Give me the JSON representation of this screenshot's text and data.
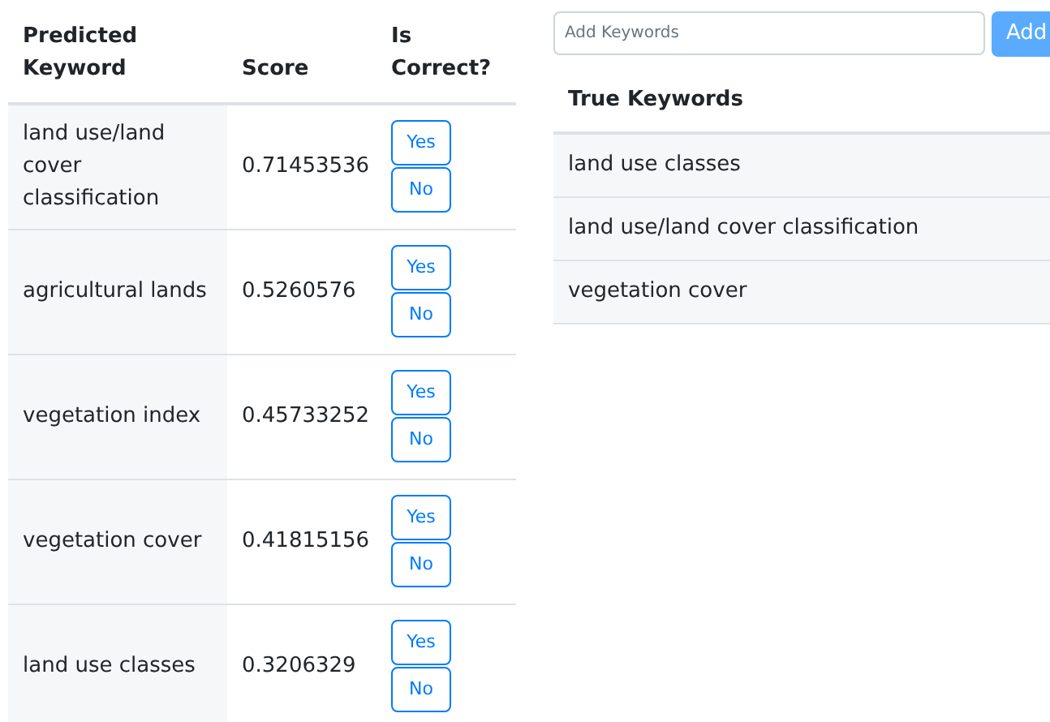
{
  "predictions": {
    "columns": [
      "Predicted Keyword",
      "Score",
      "Is Correct?"
    ],
    "rows": [
      {
        "keyword": "land use/land cover classification",
        "score": "0.71453536",
        "buttons": [
          "Yes",
          "No"
        ]
      },
      {
        "keyword": "agricultural lands",
        "score": "0.5260576",
        "buttons": [
          "Yes",
          "No"
        ]
      },
      {
        "keyword": "vegetation index",
        "score": "0.45733252",
        "buttons": [
          "Yes",
          "No"
        ]
      },
      {
        "keyword": "vegetation cover",
        "score": "0.41815156",
        "buttons": [
          "Yes",
          "No"
        ]
      },
      {
        "keyword": "land use classes",
        "score": "0.3206329",
        "buttons": [
          "Yes",
          "No"
        ]
      }
    ]
  },
  "add_keywords": {
    "placeholder": "Add Keywords",
    "button": "Add"
  },
  "true_keywords": {
    "heading": "True Keywords",
    "items": [
      "land use classes",
      "land use/land cover classification",
      "vegetation cover"
    ]
  }
}
